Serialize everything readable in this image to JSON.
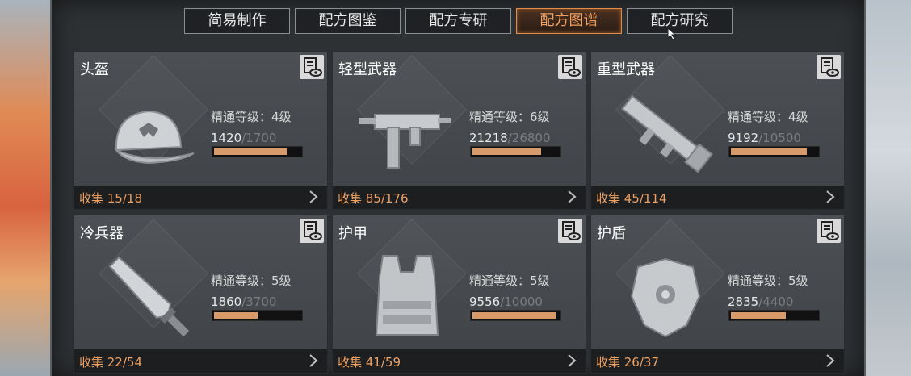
{
  "tabs": [
    {
      "label": "简易制作",
      "active": false
    },
    {
      "label": "配方图鉴",
      "active": false
    },
    {
      "label": "配方专研",
      "active": false
    },
    {
      "label": "配方图谱",
      "active": true
    },
    {
      "label": "配方研究",
      "active": false
    }
  ],
  "cards": [
    {
      "title": "头盔",
      "icon": "cap-icon",
      "mastery": "精通等级：4级",
      "current": "1420",
      "max": "1700",
      "fill": 0.84,
      "collect": "收集 15/18"
    },
    {
      "title": "轻型武器",
      "icon": "smg-icon",
      "mastery": "精通等级：6级",
      "current": "21218",
      "max": "26800",
      "fill": 0.79,
      "collect": "收集 85/176"
    },
    {
      "title": "重型武器",
      "icon": "launcher-icon",
      "mastery": "精通等级：4级",
      "current": "9192",
      "max": "10500",
      "fill": 0.88,
      "collect": "收集 45/114"
    },
    {
      "title": "冷兵器",
      "icon": "blade-icon",
      "mastery": "精通等级：5级",
      "current": "1860",
      "max": "3700",
      "fill": 0.5,
      "collect": "收集 22/54"
    },
    {
      "title": "护甲",
      "icon": "vest-icon",
      "mastery": "精通等级：5级",
      "current": "9556",
      "max": "10000",
      "fill": 0.96,
      "collect": "收集 41/59"
    },
    {
      "title": "护盾",
      "icon": "shield-icon",
      "mastery": "精通等级：5级",
      "current": "2835",
      "max": "4400",
      "fill": 0.64,
      "collect": "收集 26/37"
    }
  ],
  "colors": {
    "accent": "#f0a060",
    "bar_fill": "#d79a6a",
    "card_bg": "#4a4e52"
  }
}
